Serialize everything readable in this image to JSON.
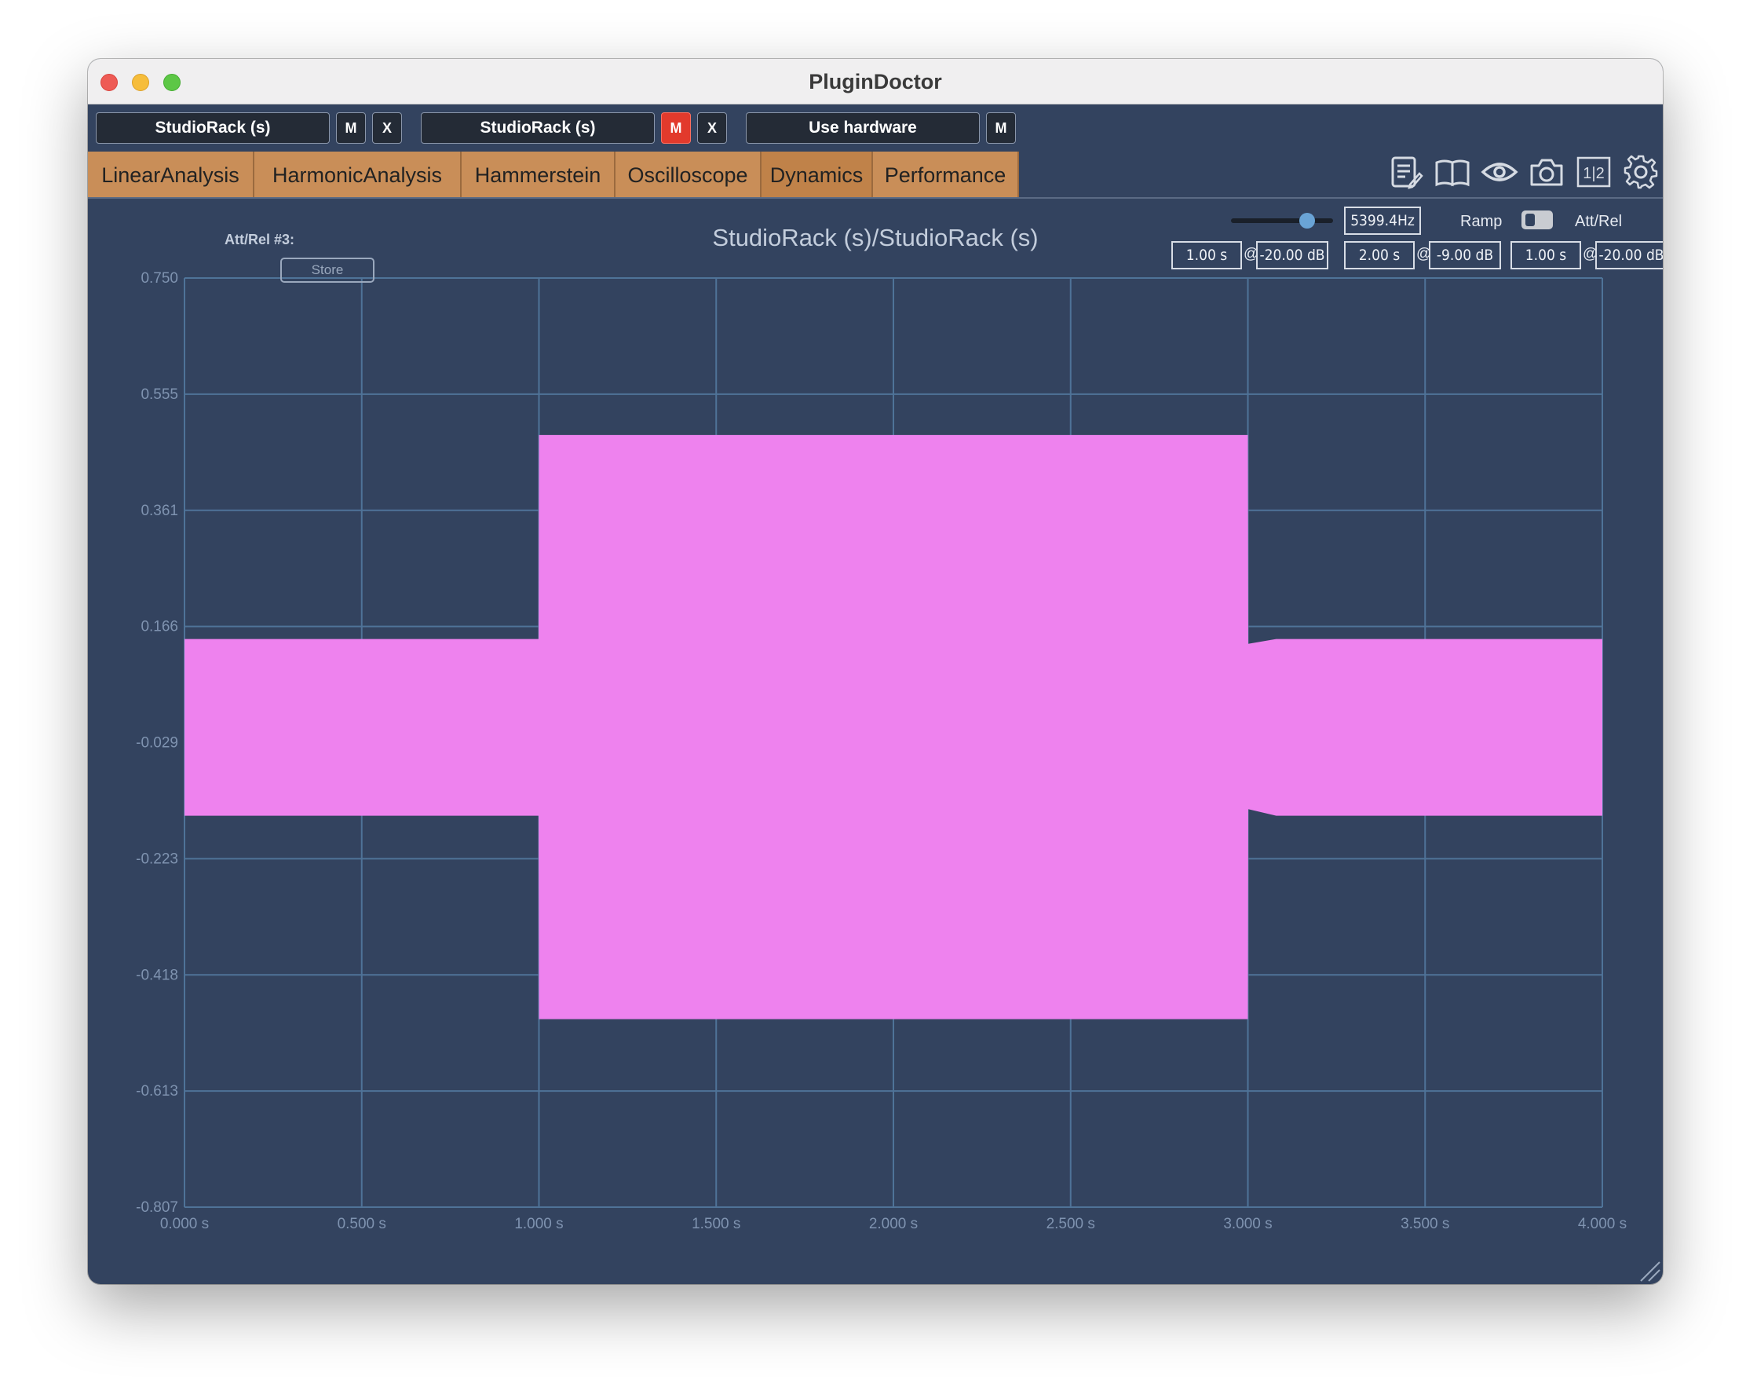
{
  "window": {
    "title": "PluginDoctor"
  },
  "slots": {
    "slot1": {
      "label": "StudioRack (s)",
      "mute": "M",
      "close": "X"
    },
    "slot2": {
      "label": "StudioRack (s)",
      "mute": "M",
      "close": "X"
    },
    "hardware": {
      "label": "Use hardware",
      "mute": "M"
    }
  },
  "tabs": [
    {
      "label": "LinearAnalysis"
    },
    {
      "label": "HarmonicAnalysis"
    },
    {
      "label": "Hammerstein"
    },
    {
      "label": "Oscilloscope"
    },
    {
      "label": "Dynamics"
    },
    {
      "label": "Performance"
    }
  ],
  "active_tab": "Dynamics",
  "toolbar_icons": [
    "notes-icon",
    "book-icon",
    "eye-icon",
    "camera-icon",
    "split-view-icon",
    "gear-icon"
  ],
  "toolbar": {
    "split_label": "1|2"
  },
  "controls": {
    "frequency": "5399.4Hz",
    "frequency_slider_fraction": 0.7,
    "ramp_label": "Ramp",
    "attrel_label": "Att/Rel",
    "att_rel_label": "Att/Rel #3:",
    "store_label": "Store",
    "stages": [
      {
        "time": "1.00 s",
        "at": "@",
        "level": "-20.00 dB"
      },
      {
        "time": "2.00 s",
        "at": "@",
        "level": "-9.00 dB"
      },
      {
        "time": "1.00 s",
        "at": "@",
        "level": "-20.00 dB"
      }
    ]
  },
  "colors": {
    "background": "#33435f",
    "grid": "#4f7398",
    "signal": "#ee82ee",
    "tab": "#c98e58"
  },
  "chart_data": {
    "type": "area",
    "title": "StudioRack (s)/StudioRack (s)",
    "x_ticks": [
      "0.000 s",
      "0.500 s",
      "1.000 s",
      "1.500 s",
      "2.000 s",
      "2.500 s",
      "3.000 s",
      "3.500 s",
      "4.000 s"
    ],
    "y_ticks": [
      "0.750",
      "0.555",
      "0.361",
      "0.166",
      "-0.029",
      "-0.223",
      "-0.418",
      "-0.613",
      "-0.807"
    ],
    "xlim": [
      0,
      4
    ],
    "ylim": [
      -0.807,
      0.75
    ],
    "grid": true,
    "envelope": {
      "x": [
        0.0,
        0.999,
        1.0,
        3.0,
        3.001,
        3.08,
        4.0
      ],
      "upper": [
        0.145,
        0.145,
        0.487,
        0.487,
        0.137,
        0.145,
        0.145
      ],
      "lower": [
        -0.151,
        -0.151,
        -0.492,
        -0.492,
        -0.14,
        -0.151,
        -0.151
      ]
    }
  }
}
